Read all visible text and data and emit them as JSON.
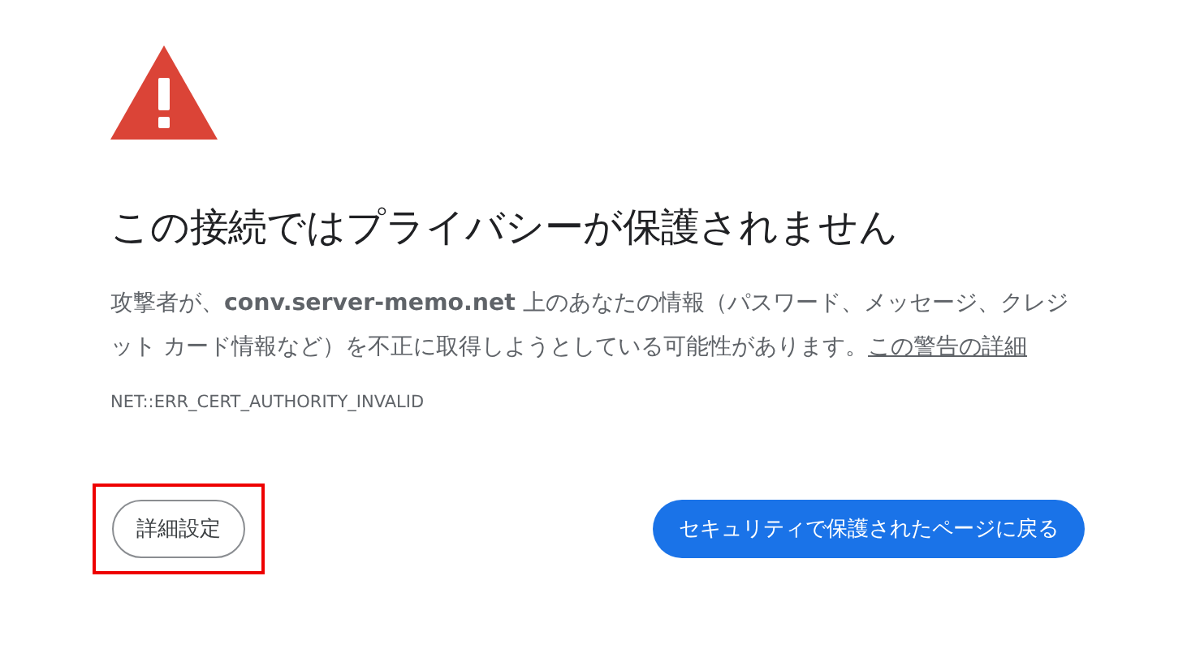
{
  "heading": "この接続ではプライバシーが保護されません",
  "message": "攻撃者が、**conv.server-memo.net** 上のあなたの情報（パスワード、メッセージ、クレジット カード情報など）を不正に取得しようとしている可能性があります。",
  "details_link": "この警告の詳細",
  "error_code": "NET::ERR_CERT_AUTHORITY_INVALID",
  "advanced_button": {
    "label": "詳細設定",
    "highlighted": true
  },
  "back_button": {
    "label": "セキュリティで保護されたページに戻る"
  }
}
